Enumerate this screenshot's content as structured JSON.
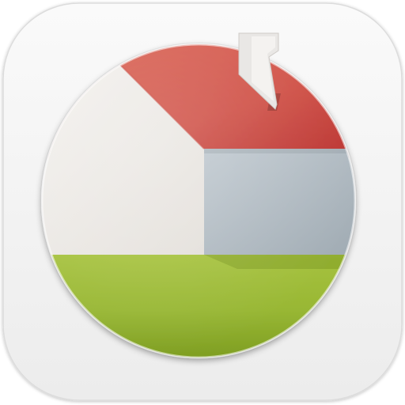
{
  "app_icon": {
    "icon": "house-disc-icon",
    "colors": {
      "tile": "#f3f3f3",
      "roof": "#d2554a",
      "wall_front": "#ece9e5",
      "wall_side": "#aeb9c1",
      "ground": "#93b330",
      "chimney": "#e8e6e4"
    }
  }
}
